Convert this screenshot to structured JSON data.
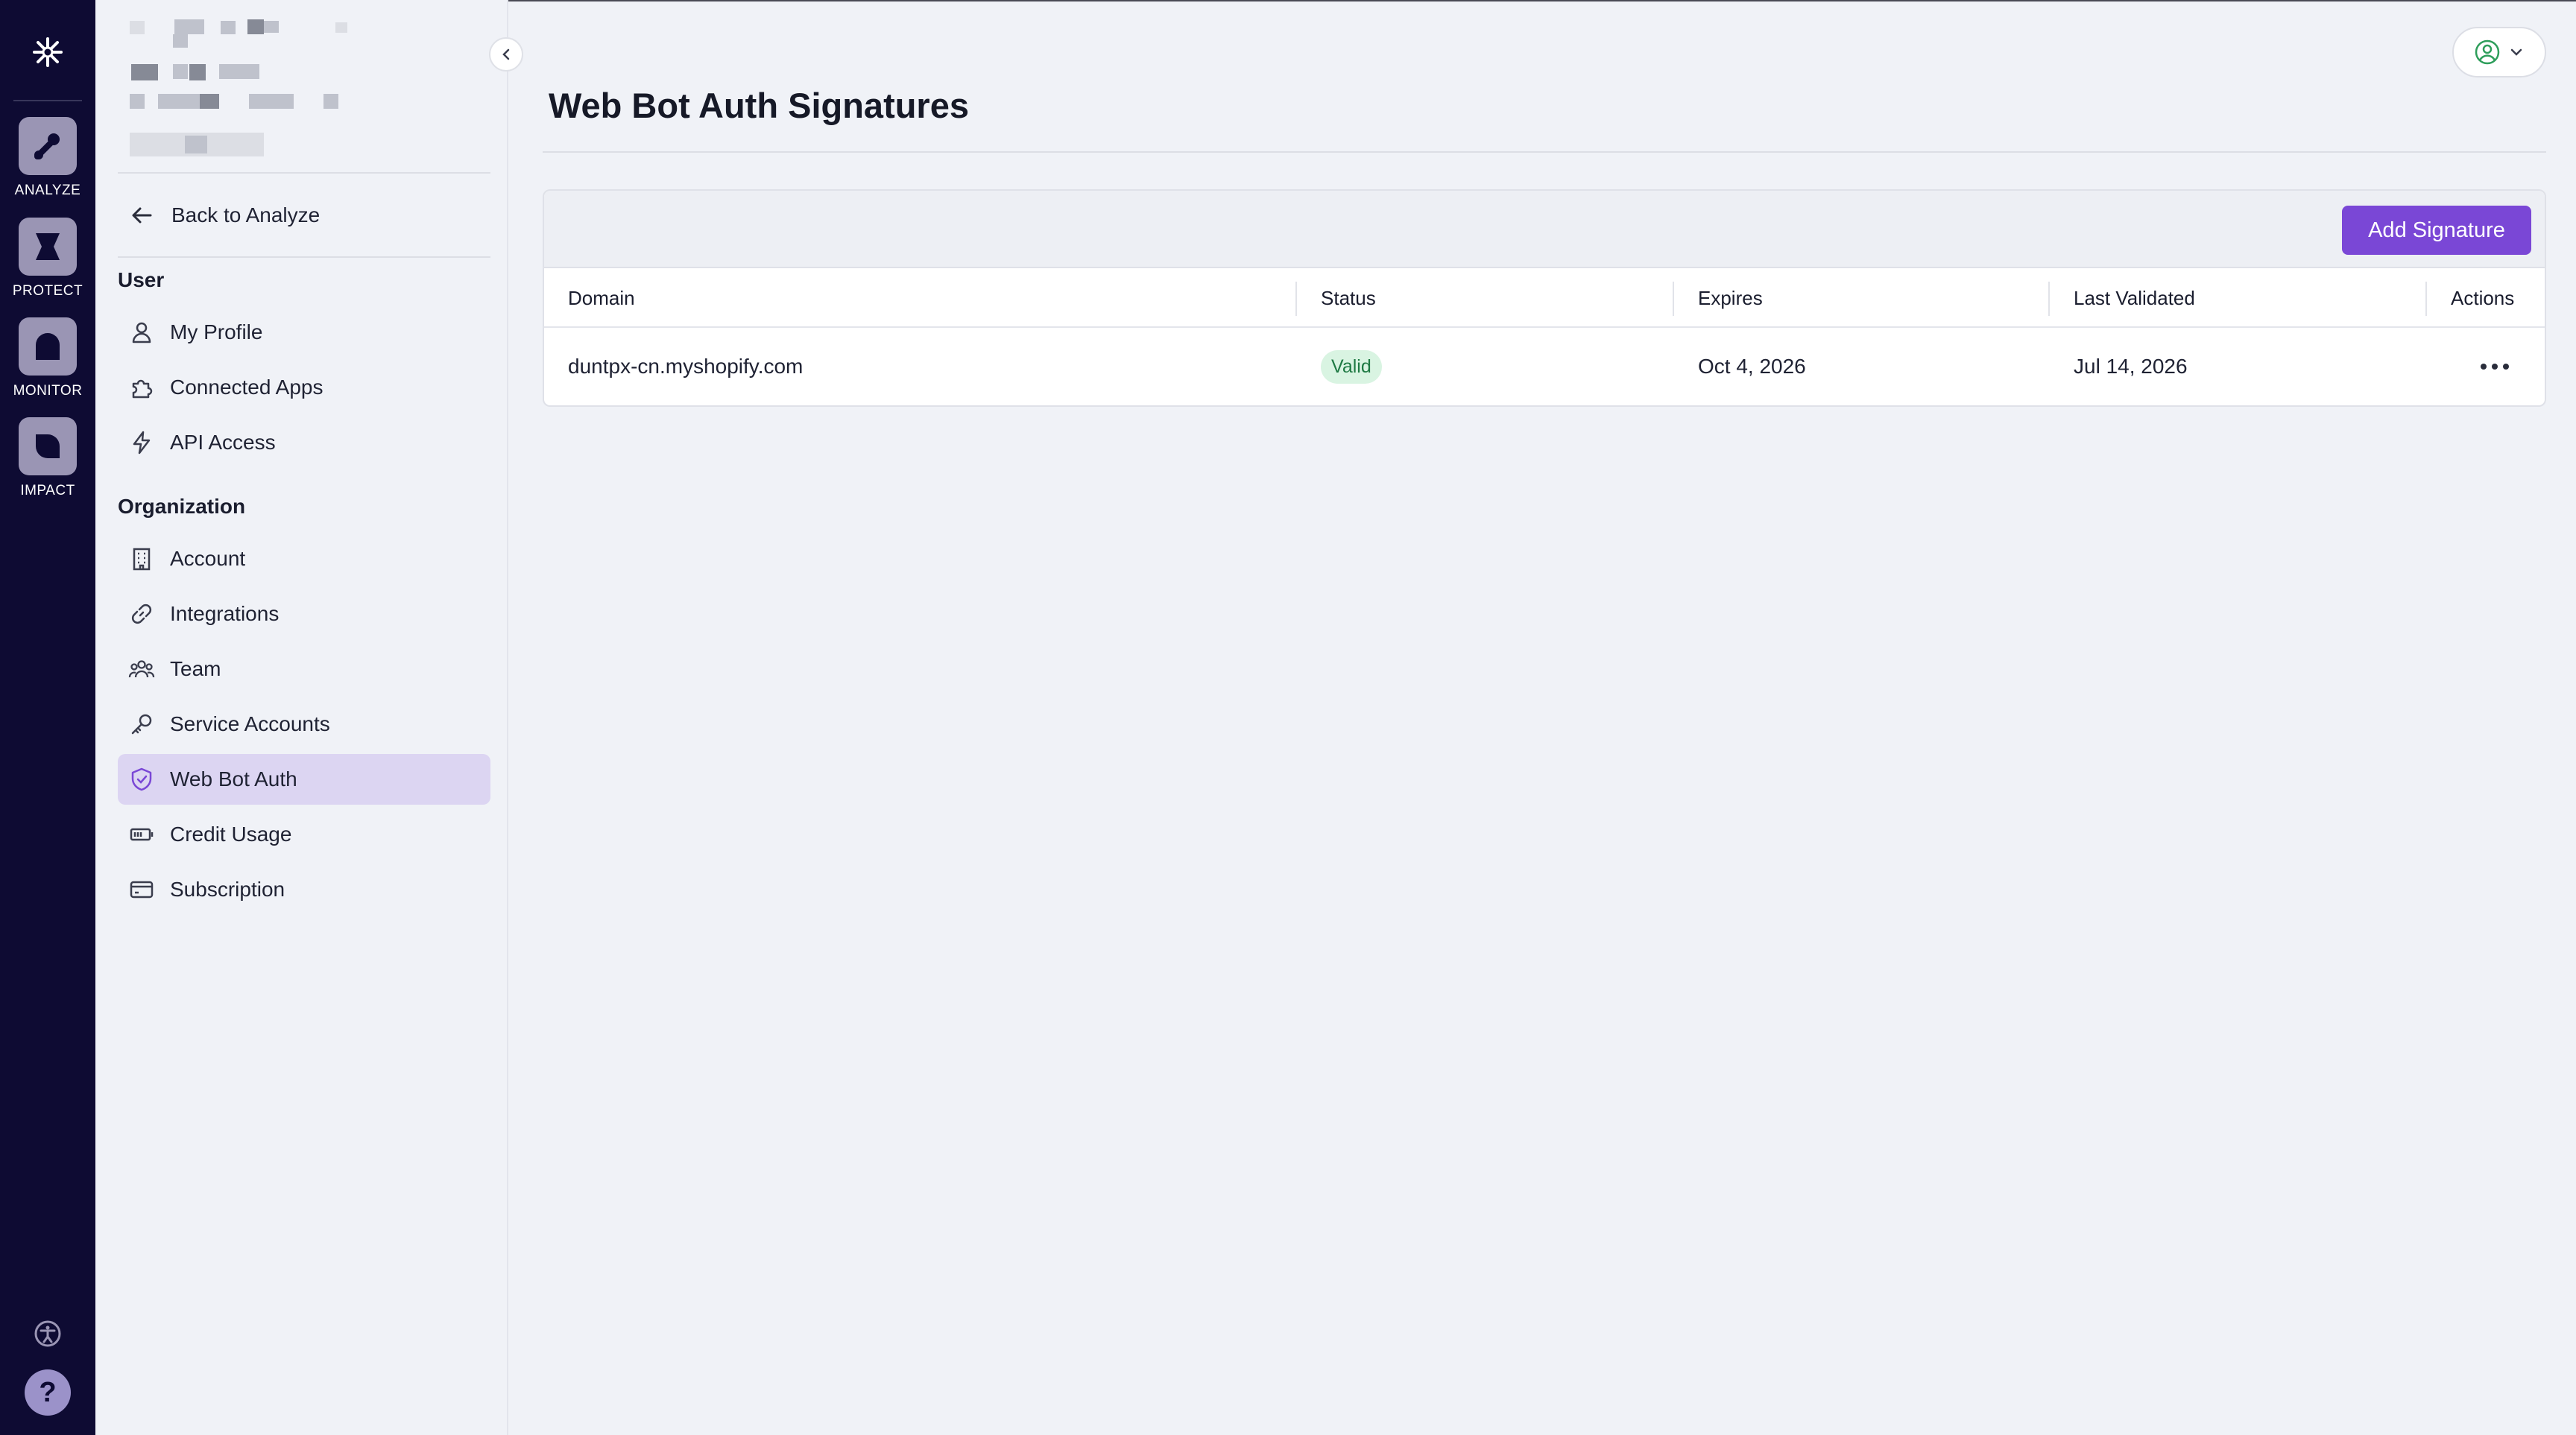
{
  "rail": {
    "items": [
      {
        "label": "ANALYZE",
        "icon": "analyze-icon"
      },
      {
        "label": "PROTECT",
        "icon": "protect-icon"
      },
      {
        "label": "MONITOR",
        "icon": "monitor-icon"
      },
      {
        "label": "IMPACT",
        "icon": "impact-icon"
      }
    ],
    "help_label": "?"
  },
  "sidebar": {
    "back_label": "Back to Analyze",
    "user_section": "User",
    "user_items": [
      {
        "label": "My Profile",
        "icon": "user-icon"
      },
      {
        "label": "Connected Apps",
        "icon": "puzzle-icon"
      },
      {
        "label": "API Access",
        "icon": "bolt-icon"
      }
    ],
    "org_section": "Organization",
    "org_items": [
      {
        "label": "Account",
        "icon": "building-icon"
      },
      {
        "label": "Integrations",
        "icon": "link-icon"
      },
      {
        "label": "Team",
        "icon": "team-icon"
      },
      {
        "label": "Service Accounts",
        "icon": "key-icon"
      },
      {
        "label": "Web Bot Auth",
        "icon": "shield-check-icon",
        "active": true
      },
      {
        "label": "Credit Usage",
        "icon": "battery-icon"
      },
      {
        "label": "Subscription",
        "icon": "card-icon"
      }
    ]
  },
  "main": {
    "title": "Web Bot Auth Signatures",
    "add_button": "Add Signature",
    "columns": [
      "Domain",
      "Status",
      "Expires",
      "Last Validated",
      "Actions"
    ],
    "rows": [
      {
        "domain": "duntpx-cn.myshopify.com",
        "status": "Valid",
        "expires": "Oct 4, 2026",
        "last_validated": "Jul 14, 2026"
      }
    ]
  },
  "colors": {
    "rail_bg": "#0e0b33",
    "accent": "#7a47d6",
    "active_nav_bg": "#dcd5f2",
    "valid_badge_bg": "#d9f4e2",
    "valid_badge_text": "#1f7a44"
  }
}
